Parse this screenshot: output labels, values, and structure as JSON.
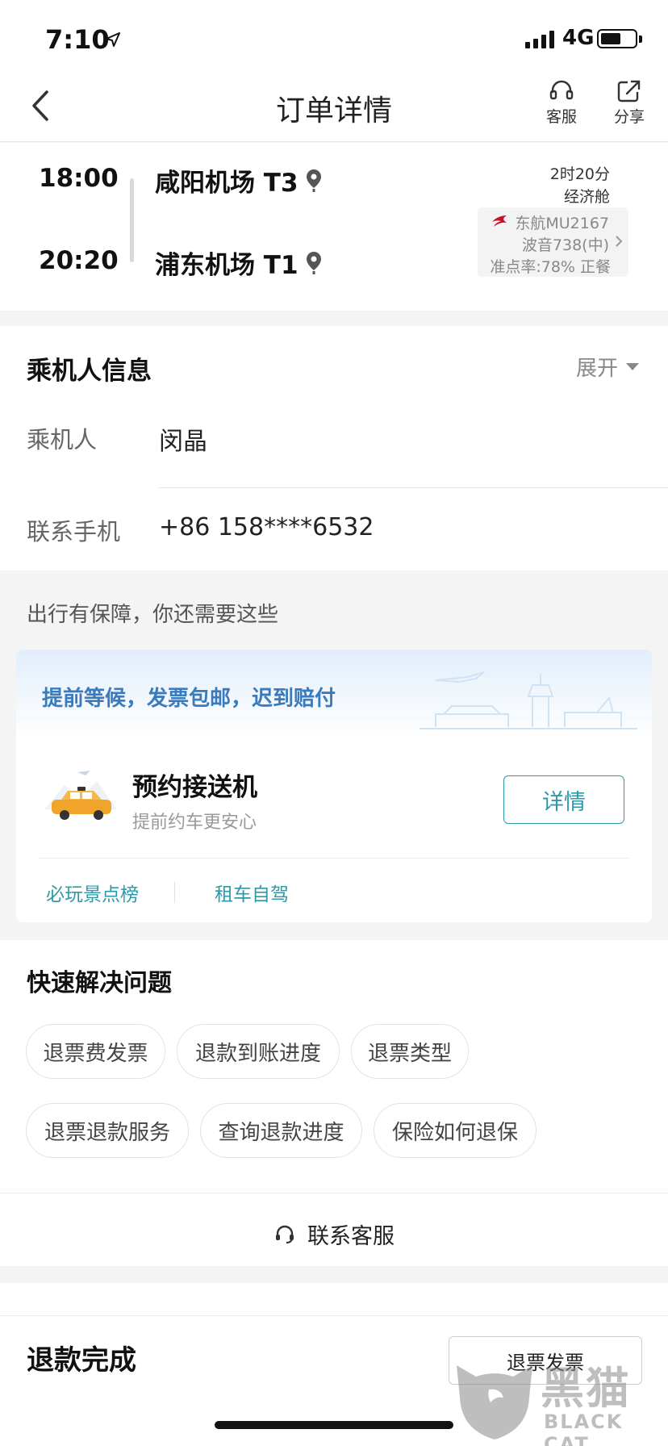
{
  "status_bar": {
    "time": "7:10",
    "network": "4G",
    "battery_level": 0.6
  },
  "nav": {
    "title": "订单详情",
    "customer_service_label": "客服",
    "share_label": "分享"
  },
  "flight": {
    "departure_time": "18:00",
    "arrival_time": "20:20",
    "departure_airport": "咸阳机场 T3",
    "arrival_airport": "浦东机场 T1",
    "duration": "2时20分",
    "cabin": "经济舱",
    "airline_flight": "东航MU2167",
    "aircraft": "波音738(中)",
    "punctuality_meal": "准点率:78% 正餐"
  },
  "passenger_section": {
    "heading": "乘机人信息",
    "expand_label": "展开",
    "passenger_label": "乘机人",
    "passenger_name": "闵晶",
    "phone_label": "联系手机",
    "phone_value": "+86 158****6532"
  },
  "extras": {
    "heading": "出行有保障，你还需要这些",
    "banner_text": "提前等候，发票包邮，迟到赔付",
    "service_title": "预约接送机",
    "service_subtitle": "提前约车更安心",
    "detail_button": "详情",
    "links": [
      "必玩景点榜",
      "租车自驾"
    ]
  },
  "quick_help": {
    "heading": "快速解决问题",
    "chips": [
      "退票费发票",
      "退款到账进度",
      "退票类型",
      "退票退款服务",
      "查询退款进度",
      "保险如何退保"
    ],
    "contact_label": "联系客服"
  },
  "bottom": {
    "refund_status": "退款完成",
    "invoice_button": "退票发票"
  },
  "watermark": {
    "cn": "黑猫",
    "en": "BLACK CAT"
  },
  "colors": {
    "accent": "#2e9aa8",
    "banner_text": "#3a7bbd",
    "airline_red": "#c8102e"
  },
  "icons": [
    "location-arrow-icon",
    "back-chevron-icon",
    "headset-icon",
    "share-icon",
    "map-pin-icon",
    "airline-logo-icon",
    "chevron-right-icon",
    "caret-down-icon",
    "taxi-icon"
  ]
}
